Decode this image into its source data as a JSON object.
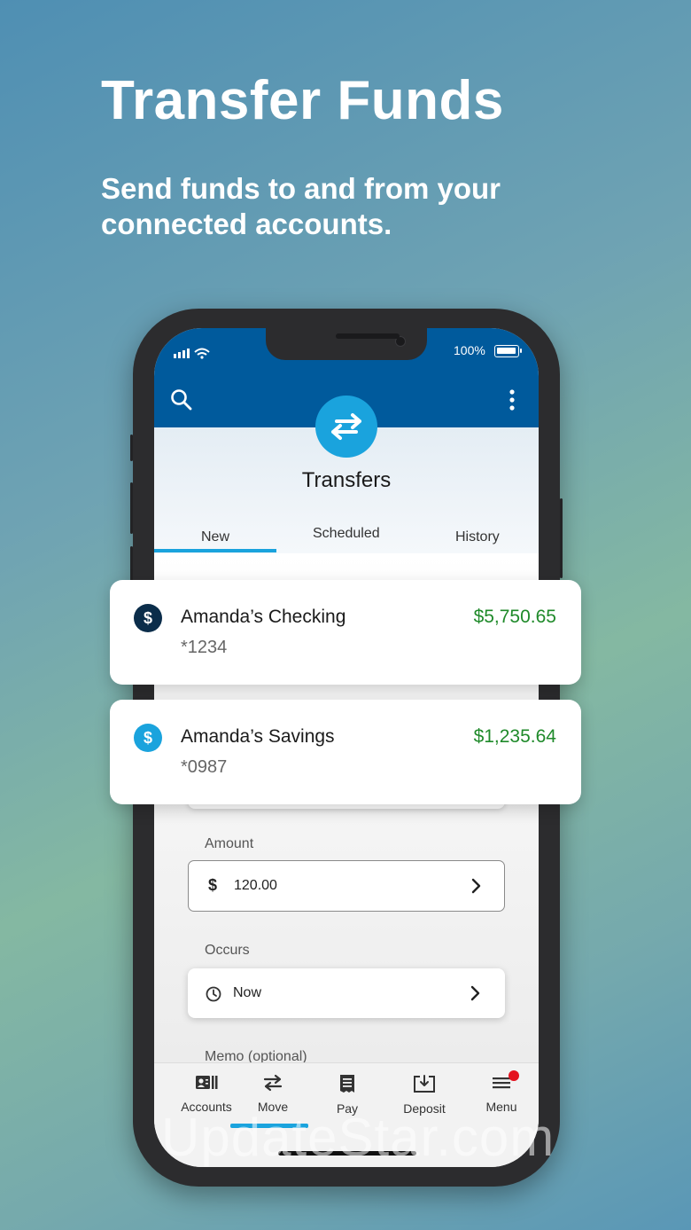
{
  "promo": {
    "headline": "Transfer Funds",
    "subline": "Send funds to and from your connected accounts."
  },
  "status_bar": {
    "battery": "100%"
  },
  "hero": {
    "title": "Transfers"
  },
  "tabs": [
    {
      "label": "New",
      "active": true
    },
    {
      "label": "Scheduled",
      "active": false
    },
    {
      "label": "History",
      "active": false
    }
  ],
  "accounts": [
    {
      "name": "Amanda’s Checking",
      "number": "*1234",
      "balance": "$5,750.65",
      "icon_color": "#0b2d4a"
    },
    {
      "name": "Amanda’s Savings",
      "number": "*0987",
      "balance": "$1,235.64",
      "icon_color": "#1aa3dd"
    }
  ],
  "form": {
    "amount_label": "Amount",
    "amount_value": "120.00",
    "currency_symbol": "$",
    "occurs_label": "Occurs",
    "occurs_value": "Now",
    "memo_label": "Memo (optional)"
  },
  "bottom_nav": [
    {
      "label": "Accounts",
      "icon": "accounts-card-icon"
    },
    {
      "label": "Move",
      "icon": "transfer-arrows-icon",
      "active": true
    },
    {
      "label": "Pay",
      "icon": "bill-icon"
    },
    {
      "label": "Deposit",
      "icon": "deposit-tray-icon"
    },
    {
      "label": "Menu",
      "icon": "hamburger-icon",
      "badge": true
    }
  ],
  "watermark": "UpdateStar.com",
  "colors": {
    "primary_blue": "#005a9c",
    "accent_blue": "#1aa3dd",
    "balance_green": "#1f8a2a",
    "notification_red": "#e4121e"
  }
}
